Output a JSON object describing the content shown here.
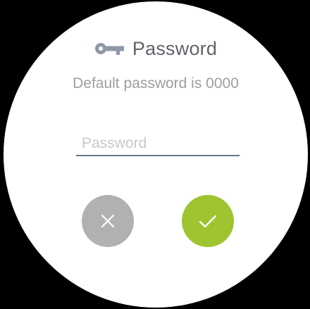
{
  "dialog": {
    "icon": "key-icon",
    "title": "Password",
    "subtitle": "Default password is 0000"
  },
  "password_field": {
    "placeholder": "Password",
    "value": ""
  },
  "buttons": {
    "cancel": {
      "icon": "close-icon",
      "color": "#b1b1b1"
    },
    "confirm": {
      "icon": "check-icon",
      "color": "#9ec42f"
    }
  },
  "colors": {
    "background": "#000000",
    "face": "#ffffff",
    "title_text": "#5f6368",
    "subtitle_text": "#9e9e9e",
    "input_underline": "#5c7a8a",
    "key_icon": "#8f96a6"
  }
}
